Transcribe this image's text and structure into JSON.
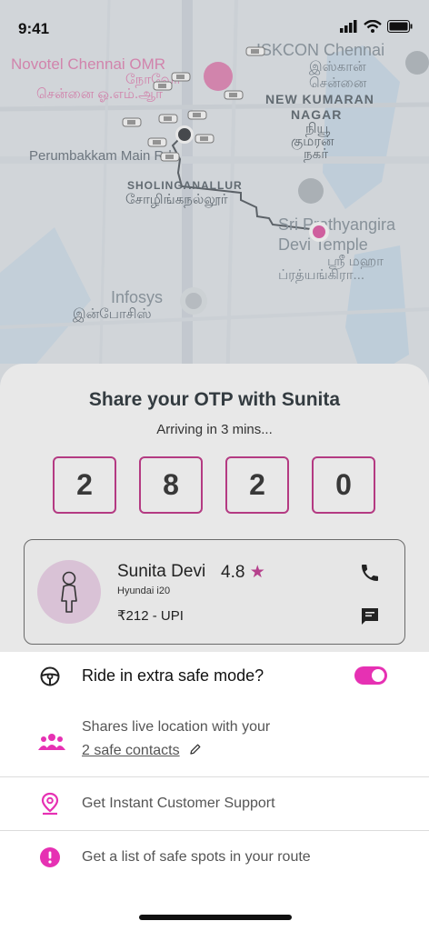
{
  "status_bar": {
    "time": "9:41"
  },
  "map": {
    "labels": {
      "novotel_en": "Novotel Chennai OMR",
      "novotel_ta1": "நோவோ",
      "novotel_ta2": "சென்னை ஓ.எம்.ஆர்",
      "iskcon_en": "ISKCON Chennai",
      "iskcon_ta1": "இஸ்கான்",
      "iskcon_ta2": "சென்னை",
      "kumaran_1": "NEW KUMARAN",
      "kumaran_2": "NAGAR",
      "kumaran_ta1": "நியூ",
      "kumaran_ta2": "குமரன்",
      "kumaran_ta3": "நகர்",
      "perumbakkam": "Perumbakkam Main Rd",
      "sholinganallur": "SHOLINGANALLUR",
      "sholinganallur_ta": "சோழிங்கநல்லூர்",
      "temple_1": "Sri Prathyangira",
      "temple_2": "Devi Temple",
      "temple_ta1": "ஸ்ரீ மஹா",
      "temple_ta2": "ப்ரத்யங்கிரா...",
      "infosys": "Infosys",
      "infosys_ta": "இன்போசிஸ்"
    }
  },
  "otp": {
    "title": "Share your OTP with Sunita",
    "subtitle": "Arriving in 3 mins...",
    "digits": [
      "2",
      "8",
      "2",
      "0"
    ]
  },
  "driver": {
    "name": "Sunita Devi",
    "rating": "4.8",
    "star": "★",
    "car": "Hyundai i20",
    "fare": "₹212 - UPI"
  },
  "safety": {
    "title": "Ride in extra safe mode?",
    "toggle_on": true,
    "shares_text": "Shares live location with your",
    "contacts_link": "2 safe contacts",
    "support": "Get Instant Customer Support",
    "safe_spots": "Get a list of safe spots in your route"
  },
  "colors": {
    "accent": "#e631b3",
    "otp_border": "#b43a82",
    "panel_bg": "#ffffff"
  },
  "icons": [
    "signal-icon",
    "wifi-icon",
    "battery-icon",
    "car-icon",
    "pin-icon",
    "person-icon",
    "phone-icon",
    "chat-icon",
    "steering-icon",
    "group-icon",
    "location-pin-icon",
    "alert-icon",
    "pencil-icon"
  ]
}
